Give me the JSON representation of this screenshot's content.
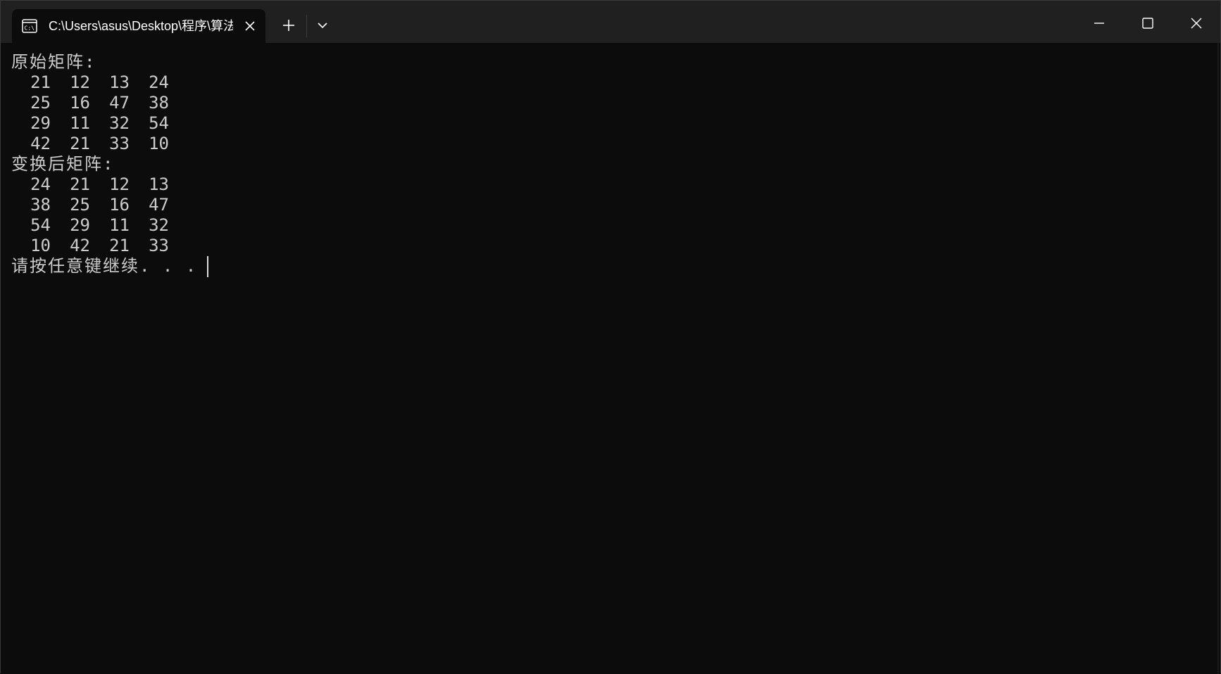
{
  "window": {
    "tab_title": "C:\\Users\\asus\\Desktop\\程序\\算法",
    "tab_icon": "terminal-icon",
    "close_tab_icon": "close-icon",
    "new_tab_icon": "plus-icon",
    "dropdown_icon": "chevron-down-icon",
    "minimize_icon": "minimize-icon",
    "maximize_icon": "maximize-icon",
    "close_icon": "close-icon"
  },
  "console": {
    "original_heading": "原始矩阵:",
    "original_matrix": [
      [
        "21",
        "12",
        "13",
        "24"
      ],
      [
        "25",
        "16",
        "47",
        "38"
      ],
      [
        "29",
        "11",
        "32",
        "54"
      ],
      [
        "42",
        "21",
        "33",
        "10"
      ]
    ],
    "transformed_heading": "变换后矩阵:",
    "transformed_matrix": [
      [
        "24",
        "21",
        "12",
        "13"
      ],
      [
        "38",
        "25",
        "16",
        "47"
      ],
      [
        "54",
        "29",
        "11",
        "32"
      ],
      [
        "10",
        "42",
        "21",
        "33"
      ]
    ],
    "prompt": "请按任意键继续. . ."
  },
  "colors": {
    "background": "#0c0c0c",
    "titlebar": "#202020",
    "text": "#cccccc"
  }
}
